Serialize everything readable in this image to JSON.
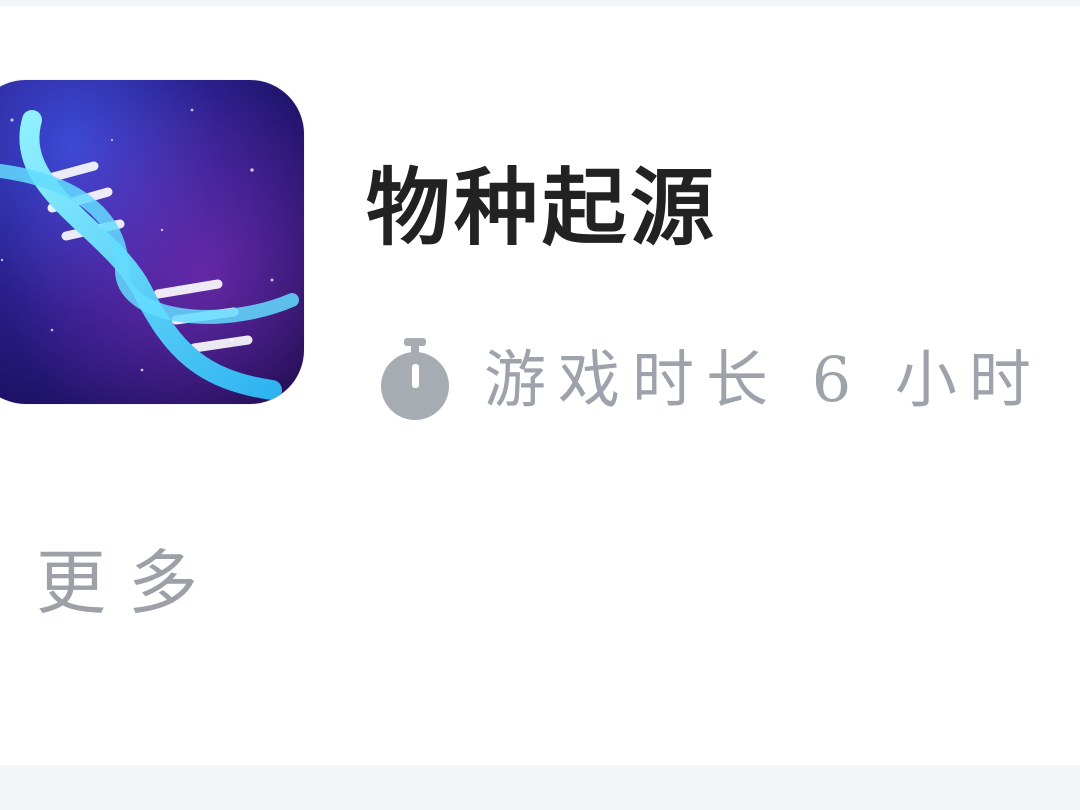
{
  "game": {
    "title": "物种起源",
    "playtime_label": "游戏时长 6 小时",
    "icon": "dna-helix-icon"
  },
  "more_label": "更多",
  "colors": {
    "title": "#222222",
    "muted": "#9ea2aa",
    "icon_bg": "#2a1e8a",
    "icon_helix": "#4fd4ff",
    "band": "#f4f5f8"
  }
}
